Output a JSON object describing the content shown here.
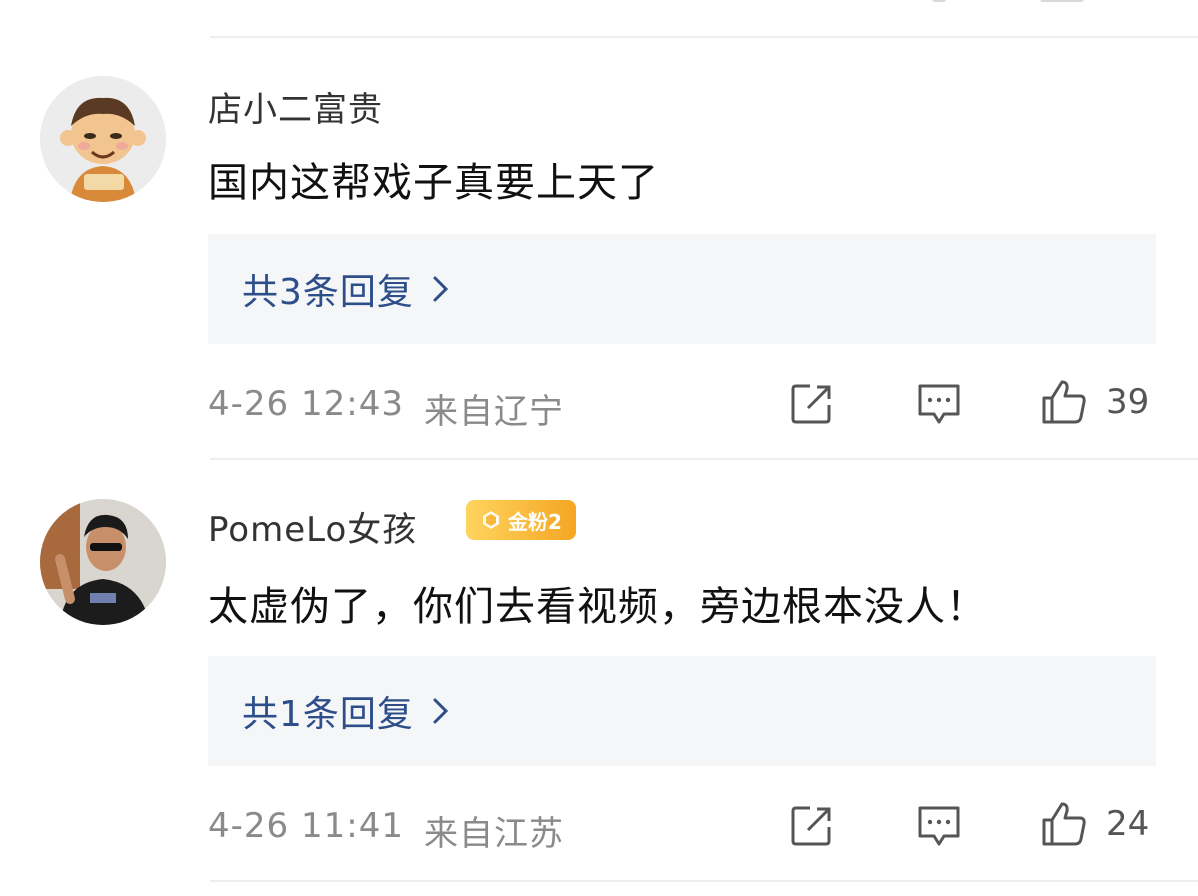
{
  "comments": [
    {
      "username": "店小二富贵",
      "badge": "",
      "text": "国内这帮戏子真要上天了",
      "replies_label": "共3条回复",
      "date": "4-26 12:43",
      "location": "来自辽宁",
      "likes": "39",
      "avatar_icon": "cartoon-waiter-avatar"
    },
    {
      "username": "PomeLo女孩",
      "badge": "金粉2",
      "text": "太虚伪了，你们去看视频，旁边根本没人！",
      "replies_label": "共1条回复",
      "date": "4-26 11:41",
      "location": "来自江苏",
      "likes": "24",
      "avatar_icon": "person-photo-avatar"
    }
  ],
  "colors": {
    "reply_link": "#2e4e8a",
    "badge_gold": "#f4a623",
    "meta_gray": "#8a8a8a"
  }
}
